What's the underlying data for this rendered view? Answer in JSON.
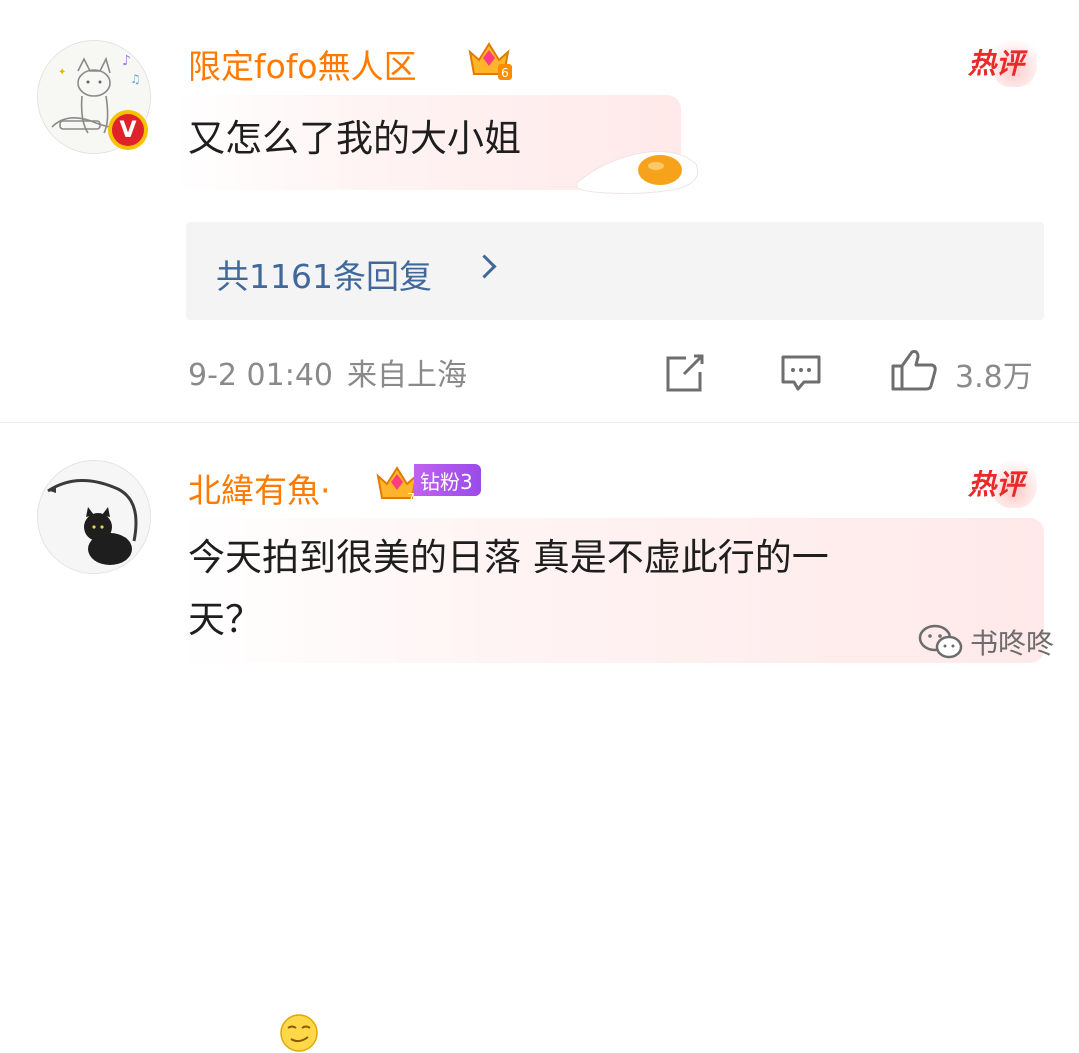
{
  "comments": [
    {
      "username": "限定fofo無人区",
      "crown_level": "6",
      "verified": "V",
      "hot_label": "热评",
      "text": "又怎么了我的大小姐",
      "replies_label": "共1161条回复",
      "date": "9-2 01:40",
      "location": "来自上海",
      "likes": "3.8万"
    },
    {
      "username": "北緯有魚",
      "separator": "·",
      "crown_level": "7",
      "fan_badge": "钻粉3",
      "hot_label": "热评",
      "text_line1": "今天拍到很美的日落 真是不虚此行的一",
      "text_line2": "天？"
    }
  ],
  "watermark": "书咚咚",
  "colors": {
    "username": "#ff7a00",
    "link": "#41689b",
    "hot": "#ea2a2a",
    "meta": "#8a8a8a"
  },
  "icons": {
    "share": "edit-share-icon",
    "comment": "comment-icon",
    "like": "thumbs-up-icon",
    "chevron": "chevron-right-icon"
  }
}
